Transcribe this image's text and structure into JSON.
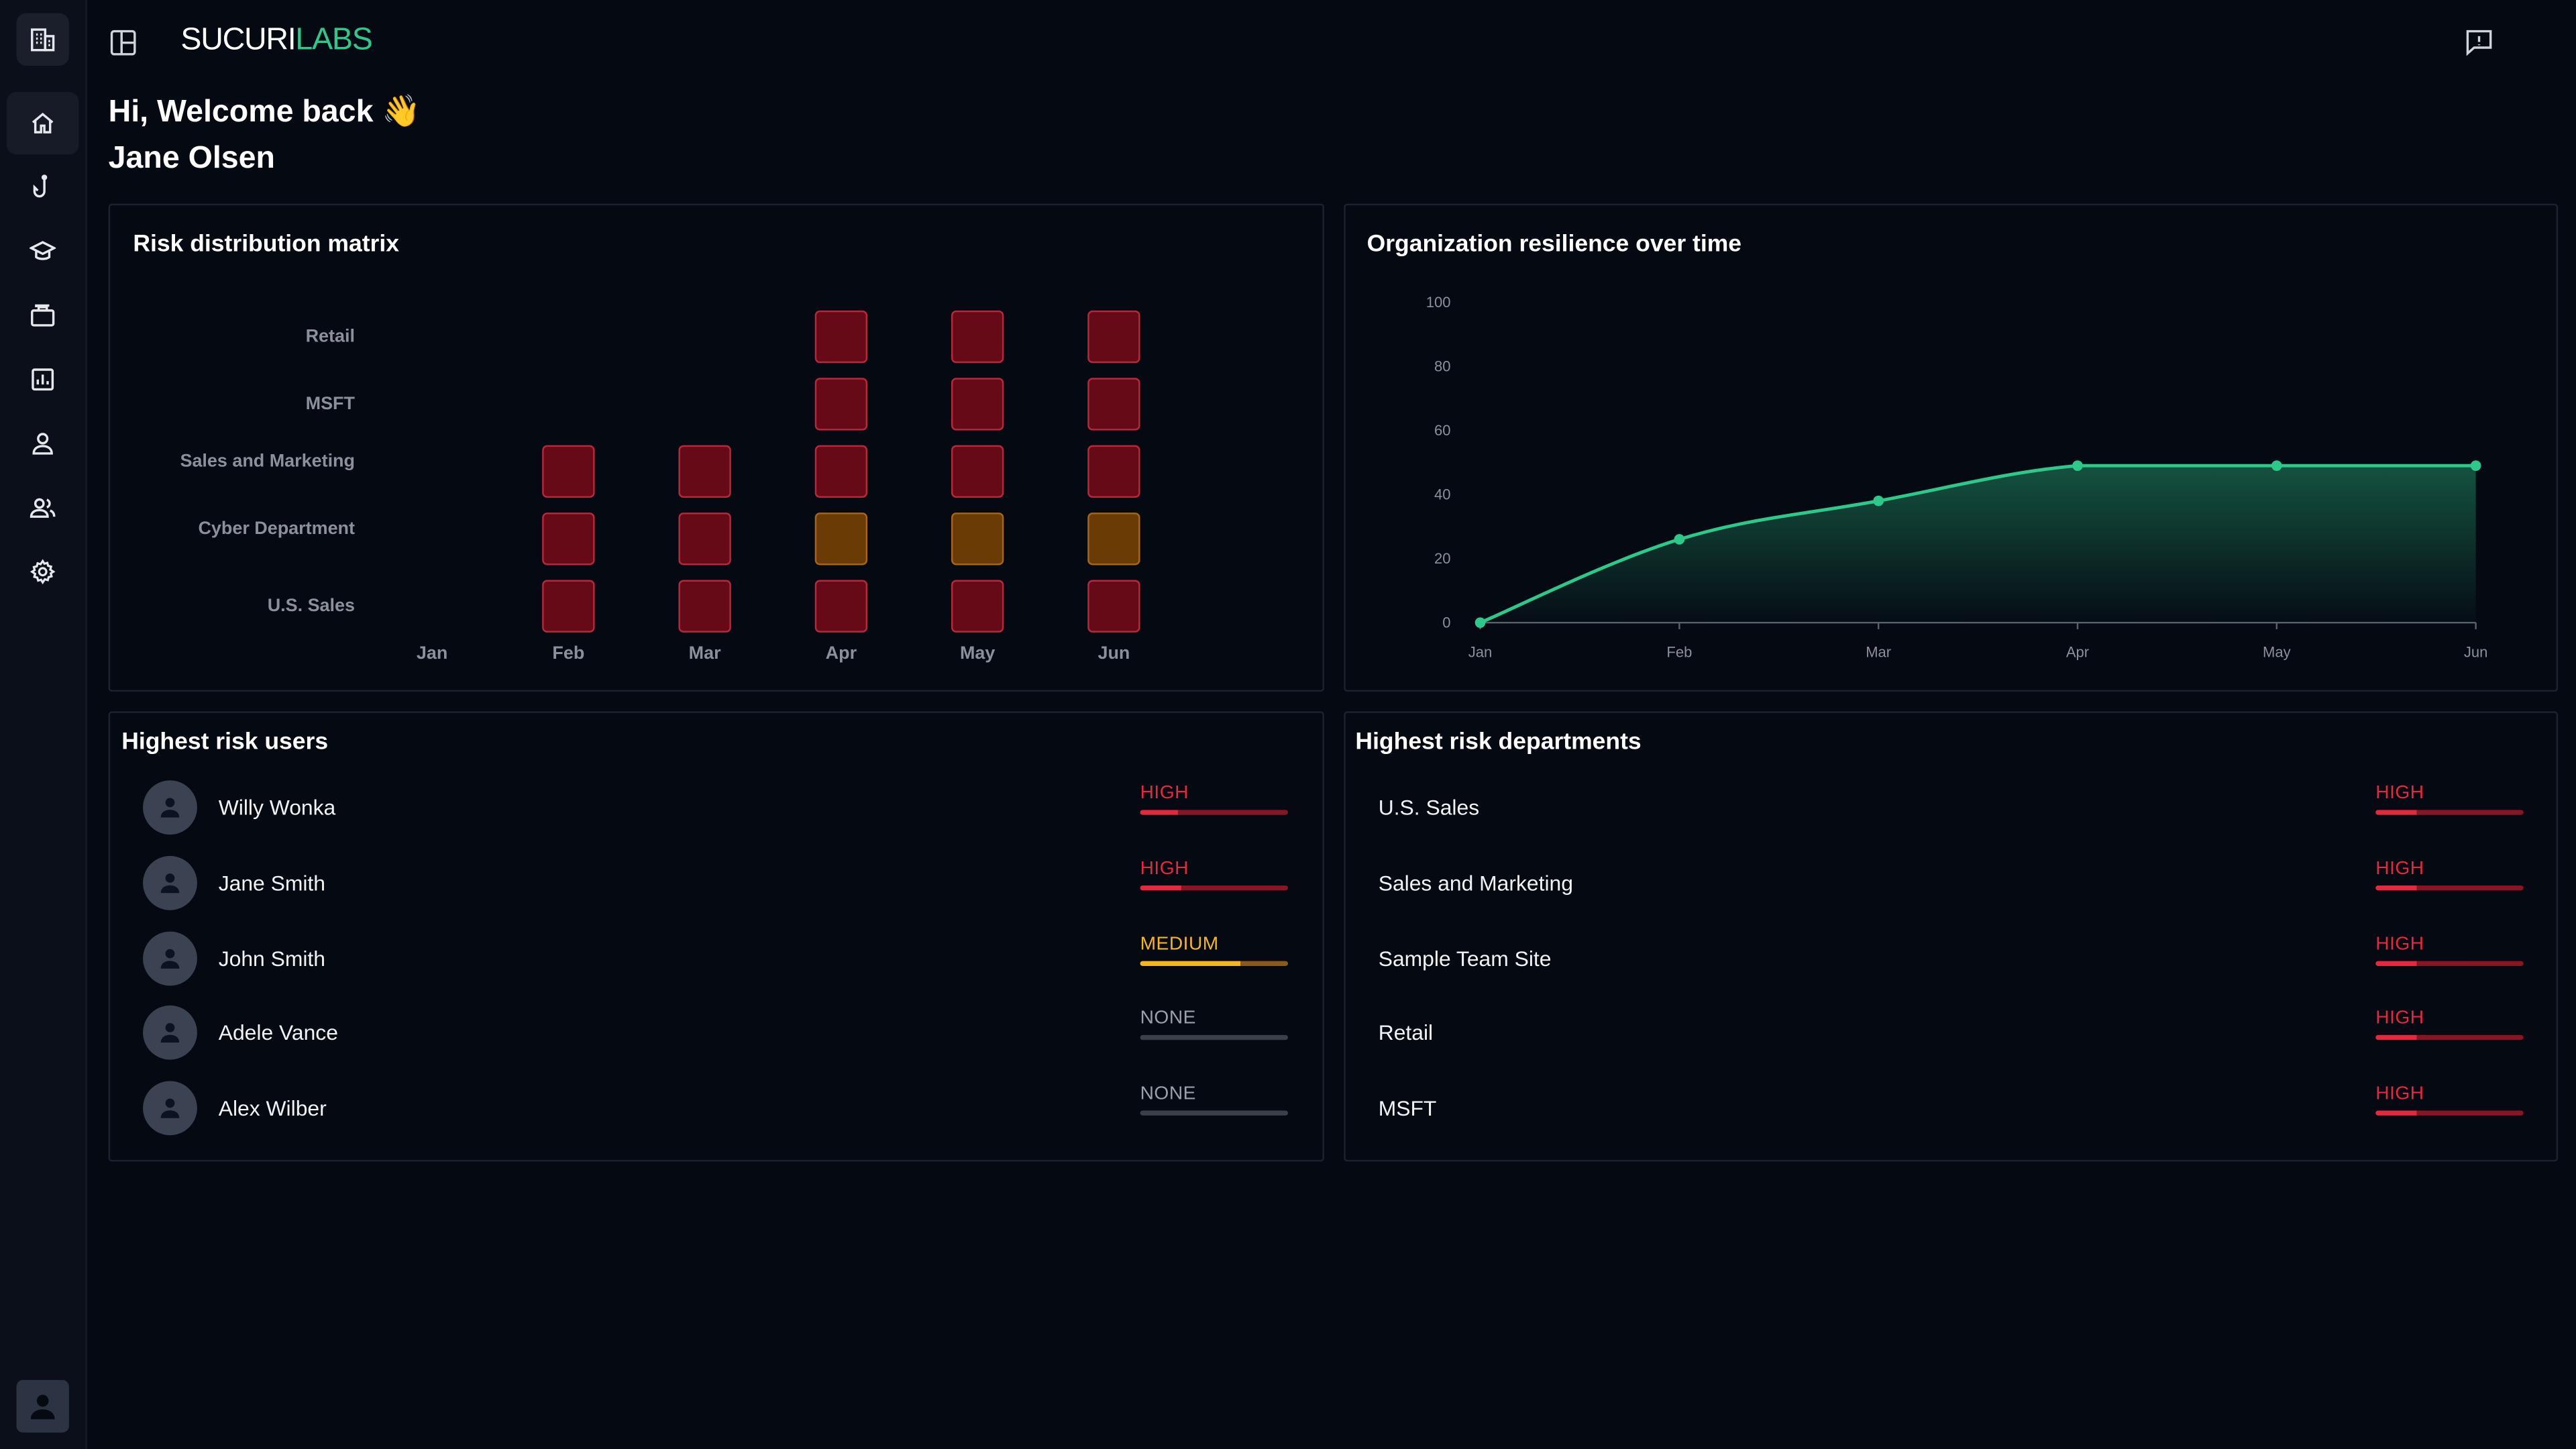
{
  "brand": {
    "part1": "SUCURI",
    "part2": "LABS"
  },
  "greeting": "Hi, Welcome back 👋",
  "user_name": "Jane Olsen",
  "sidebar": {
    "items": [
      {
        "icon": "home-icon",
        "active": true
      },
      {
        "icon": "fishing-hook-icon"
      },
      {
        "icon": "graduation-cap-icon"
      },
      {
        "icon": "briefcase-icon"
      },
      {
        "icon": "bar-chart-icon"
      },
      {
        "icon": "user-icon"
      },
      {
        "icon": "users-icon"
      },
      {
        "icon": "gear-icon"
      }
    ]
  },
  "matrix": {
    "title": "Risk distribution matrix",
    "rows": [
      "Retail",
      "MSFT",
      "Sales and Marketing",
      "Cyber Department",
      "U.S. Sales"
    ],
    "columns": [
      "Jan",
      "Feb",
      "Mar",
      "Apr",
      "May",
      "Jun"
    ],
    "cells": [
      [
        "none",
        "none",
        "none",
        "high",
        "high",
        "high"
      ],
      [
        "none",
        "none",
        "none",
        "high",
        "high",
        "high"
      ],
      [
        "none",
        "high",
        "high",
        "high",
        "high",
        "high"
      ],
      [
        "none",
        "high",
        "high",
        "medium",
        "medium",
        "medium"
      ],
      [
        "none",
        "high",
        "high",
        "high",
        "high",
        "high"
      ]
    ],
    "colors": {
      "high": "#660a18",
      "medium": "#6b3b05"
    }
  },
  "chart_data": {
    "type": "area",
    "title": "Organization resilience over time",
    "x": [
      "Jan",
      "Feb",
      "Mar",
      "Apr",
      "May",
      "Jun"
    ],
    "series": [
      {
        "values": [
          0,
          26,
          38,
          49,
          49,
          49
        ]
      }
    ],
    "ylim": [
      0,
      100
    ],
    "yticks": [
      0,
      20,
      40,
      60,
      80,
      100
    ],
    "color": "#2dc98a"
  },
  "risk_users": {
    "title": "Highest risk users",
    "items": [
      {
        "name": "Willy Wonka",
        "risk": "HIGH",
        "level": 0.26
      },
      {
        "name": "Jane Smith",
        "risk": "HIGH",
        "level": 0.28
      },
      {
        "name": "John Smith",
        "risk": "MEDIUM",
        "level": 0.68
      },
      {
        "name": "Adele Vance",
        "risk": "NONE",
        "level": 0
      },
      {
        "name": "Alex Wilber",
        "risk": "NONE",
        "level": 0
      }
    ]
  },
  "risk_departments": {
    "title": "Highest risk departments",
    "items": [
      {
        "name": "U.S. Sales",
        "risk": "HIGH",
        "level": 0.28
      },
      {
        "name": "Sales and Marketing",
        "risk": "HIGH",
        "level": 0.28
      },
      {
        "name": "Sample Team Site",
        "risk": "HIGH",
        "level": 0.28
      },
      {
        "name": "Retail",
        "risk": "HIGH",
        "level": 0.28
      },
      {
        "name": "MSFT",
        "risk": "HIGH",
        "level": 0.28
      }
    ]
  },
  "risk_colors": {
    "HIGH": "#e6283f",
    "MEDIUM": "#f5b51d",
    "NONE": "#9aa0ab"
  }
}
